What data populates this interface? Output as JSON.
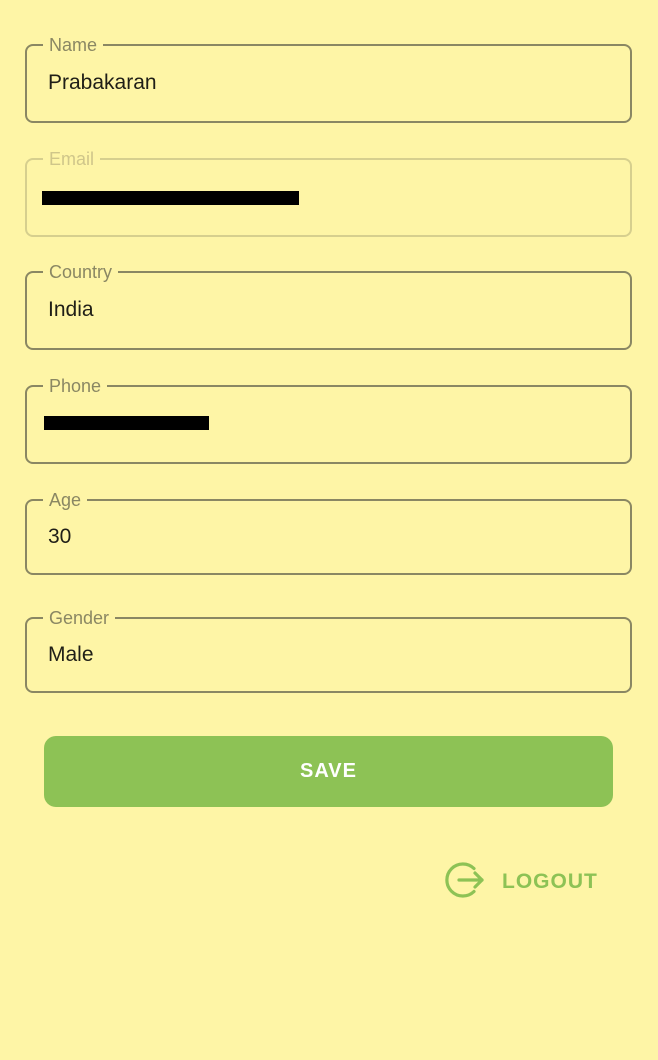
{
  "form": {
    "name": {
      "label": "Name",
      "value": "Prabakaran"
    },
    "email": {
      "label": "Email",
      "value": ""
    },
    "country": {
      "label": "Country",
      "value": "India"
    },
    "phone": {
      "label": "Phone",
      "value": ""
    },
    "age": {
      "label": "Age",
      "value": "30"
    },
    "gender": {
      "label": "Gender",
      "value": "Male"
    }
  },
  "actions": {
    "save_label": "SAVE",
    "logout_label": "LOGOUT"
  },
  "colors": {
    "background": "#fef5a6",
    "border": "#8a8763",
    "accent": "#8dc255"
  },
  "icons": {
    "logout": "logout-icon"
  }
}
